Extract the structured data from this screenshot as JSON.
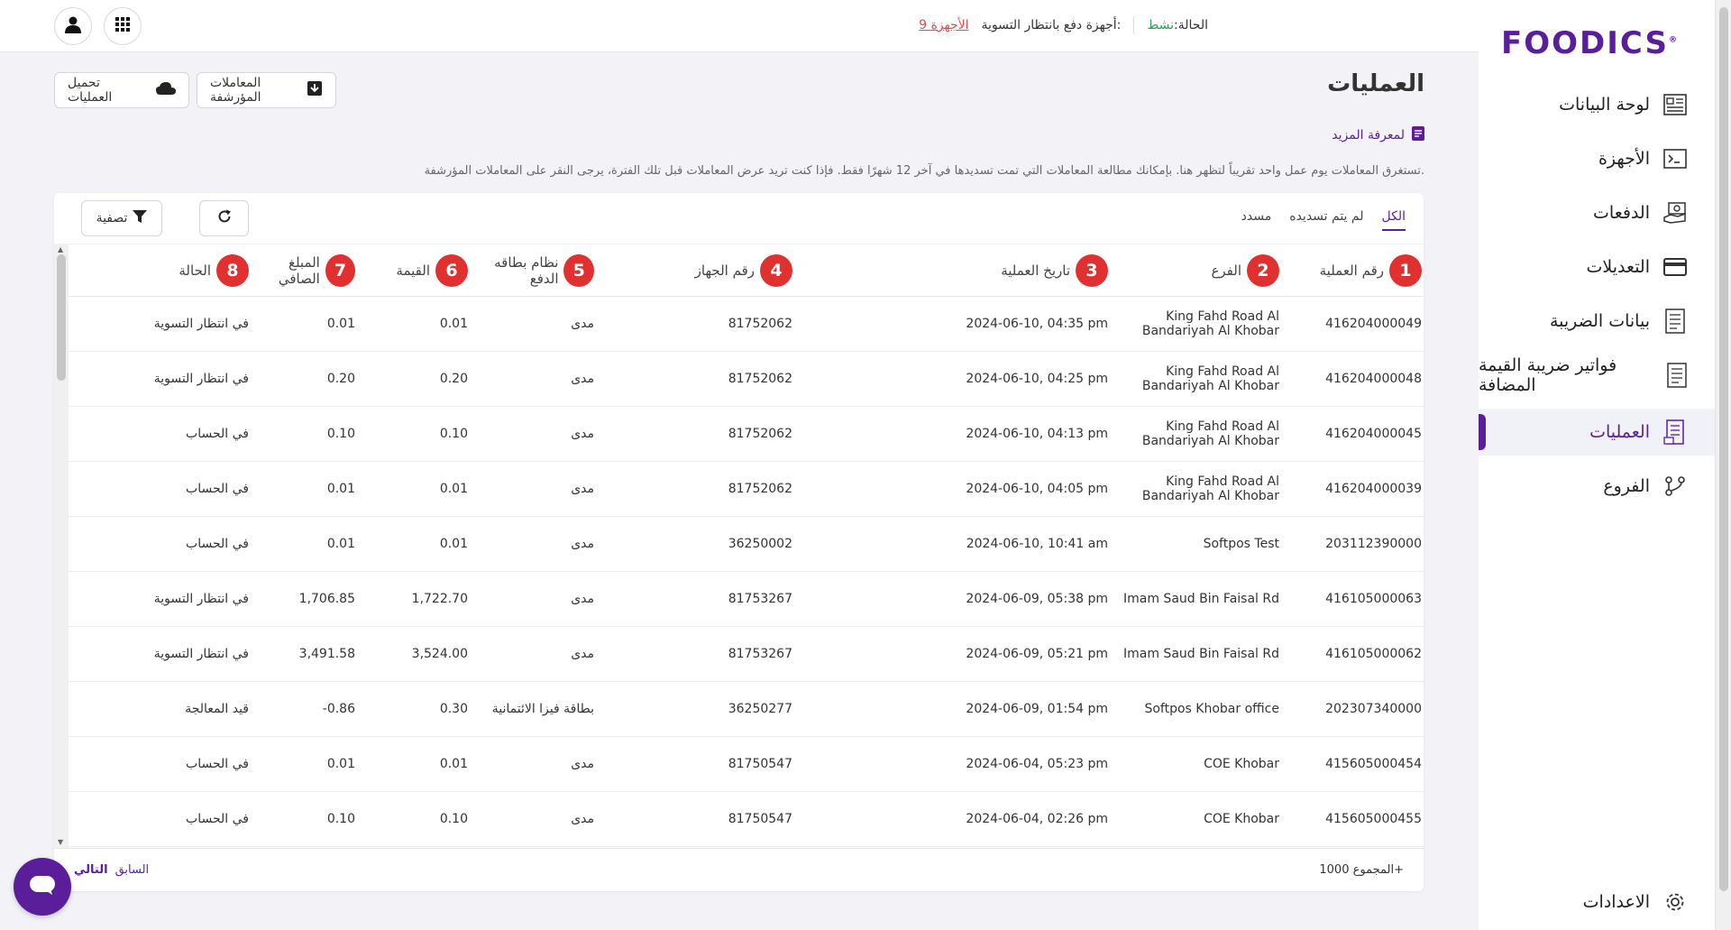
{
  "brand": {
    "logo": "FOODICS",
    "accent": "#5a1e9b"
  },
  "topbar": {
    "status_label": "الحالة:",
    "status_value": "نشط",
    "pending_label": "أجهزة دفع بانتظار التسوية:",
    "pending_value": "9 الأجهزة"
  },
  "sidebar": {
    "items": [
      {
        "label": "لوحة البيانات",
        "icon": "dashboard-icon"
      },
      {
        "label": "الأجهزة",
        "icon": "terminal-icon"
      },
      {
        "label": "الدفعات",
        "icon": "payments-icon"
      },
      {
        "label": "التعديلات",
        "icon": "card-icon"
      },
      {
        "label": "بيانات الضريبة",
        "icon": "tax-doc-icon"
      },
      {
        "label": "فواتير ضريبة القيمة المضافة",
        "icon": "invoice-icon"
      },
      {
        "label": "العمليات",
        "icon": "transactions-icon"
      },
      {
        "label": "الفروع",
        "icon": "branches-icon"
      }
    ],
    "settings_label": "الاعدادات"
  },
  "header": {
    "title": "العمليات",
    "learn_more": "لمعرفة المزيد",
    "description": "تستغرق المعاملات يوم عمل واحد تقريباً لتظهر هنا. بإمكانك مطالعة المعاملات التي تمت تسديدها في آخر 12 شهرًا فقط. فإذا كنت تريد عرض المعاملات قبل تلك الفترة، يرجى النقر على المعاملات المؤرشفة.",
    "archived_button": "المعاملات المؤرشفة",
    "download_button": "تحميل العمليات"
  },
  "tabs": {
    "all": "الكل",
    "unpaid": "لم يتم تسديده",
    "paid": "مسدد"
  },
  "toolbar": {
    "filter_label": "تصفية"
  },
  "table": {
    "headers": [
      {
        "label": "رقم العملية",
        "badge": "1"
      },
      {
        "label": "الفرع",
        "badge": "2"
      },
      {
        "label": "تاريخ العملية",
        "badge": "3"
      },
      {
        "label": "رقم الجهاز",
        "badge": "4"
      },
      {
        "label": "نظام بطاقه الدفع",
        "badge": "5"
      },
      {
        "label": "القيمة",
        "badge": "6"
      },
      {
        "label": "المبلغ الصافي",
        "badge": "7"
      },
      {
        "label": "الحالة",
        "badge": "8"
      }
    ],
    "rows": [
      {
        "id": "416204000049",
        "branch": "King Fahd Road Al Bandariyah Al Khobar",
        "date": "2024-06-10, 04:35 pm",
        "device": "81752062",
        "scheme": "مدى",
        "amount": "0.01",
        "net": "0.01",
        "status": "في انتظار التسوية"
      },
      {
        "id": "416204000048",
        "branch": "King Fahd Road Al Bandariyah Al Khobar",
        "date": "2024-06-10, 04:25 pm",
        "device": "81752062",
        "scheme": "مدى",
        "amount": "0.20",
        "net": "0.20",
        "status": "في انتظار التسوية"
      },
      {
        "id": "416204000045",
        "branch": "King Fahd Road Al Bandariyah Al Khobar",
        "date": "2024-06-10, 04:13 pm",
        "device": "81752062",
        "scheme": "مدى",
        "amount": "0.10",
        "net": "0.10",
        "status": "في الحساب"
      },
      {
        "id": "416204000039",
        "branch": "King Fahd Road Al Bandariyah Al Khobar",
        "date": "2024-06-10, 04:05 pm",
        "device": "81752062",
        "scheme": "مدى",
        "amount": "0.01",
        "net": "0.01",
        "status": "في الحساب"
      },
      {
        "id": "203112390000",
        "branch": "Softpos Test",
        "date": "2024-06-10, 10:41 am",
        "device": "36250002",
        "scheme": "مدى",
        "amount": "0.01",
        "net": "0.01",
        "status": "في الحساب"
      },
      {
        "id": "416105000063",
        "branch": "Imam Saud Bin Faisal Rd",
        "date": "2024-06-09, 05:38 pm",
        "device": "81753267",
        "scheme": "مدى",
        "amount": "1,722.70",
        "net": "1,706.85",
        "status": "في انتظار التسوية"
      },
      {
        "id": "416105000062",
        "branch": "Imam Saud Bin Faisal Rd",
        "date": "2024-06-09, 05:21 pm",
        "device": "81753267",
        "scheme": "مدى",
        "amount": "3,524.00",
        "net": "3,491.58",
        "status": "في انتظار التسوية"
      },
      {
        "id": "202307340000",
        "branch": "Softpos Khobar office",
        "date": "2024-06-09, 01:54 pm",
        "device": "36250277",
        "scheme": "بطاقة فيزا الائتمانية",
        "amount": "0.30",
        "net": "-0.86",
        "status": "قيد المعالجة"
      },
      {
        "id": "415605000454",
        "branch": "COE Khobar",
        "date": "2024-06-04, 05:23 pm",
        "device": "81750547",
        "scheme": "مدى",
        "amount": "0.01",
        "net": "0.01",
        "status": "في الحساب"
      },
      {
        "id": "415605000455",
        "branch": "COE Khobar",
        "date": "2024-06-04, 02:26 pm",
        "device": "81750547",
        "scheme": "مدى",
        "amount": "0.10",
        "net": "0.10",
        "status": "في الحساب"
      }
    ]
  },
  "footer": {
    "total": "المجموع 1000+",
    "prev": "السابق",
    "next": "التالي"
  }
}
